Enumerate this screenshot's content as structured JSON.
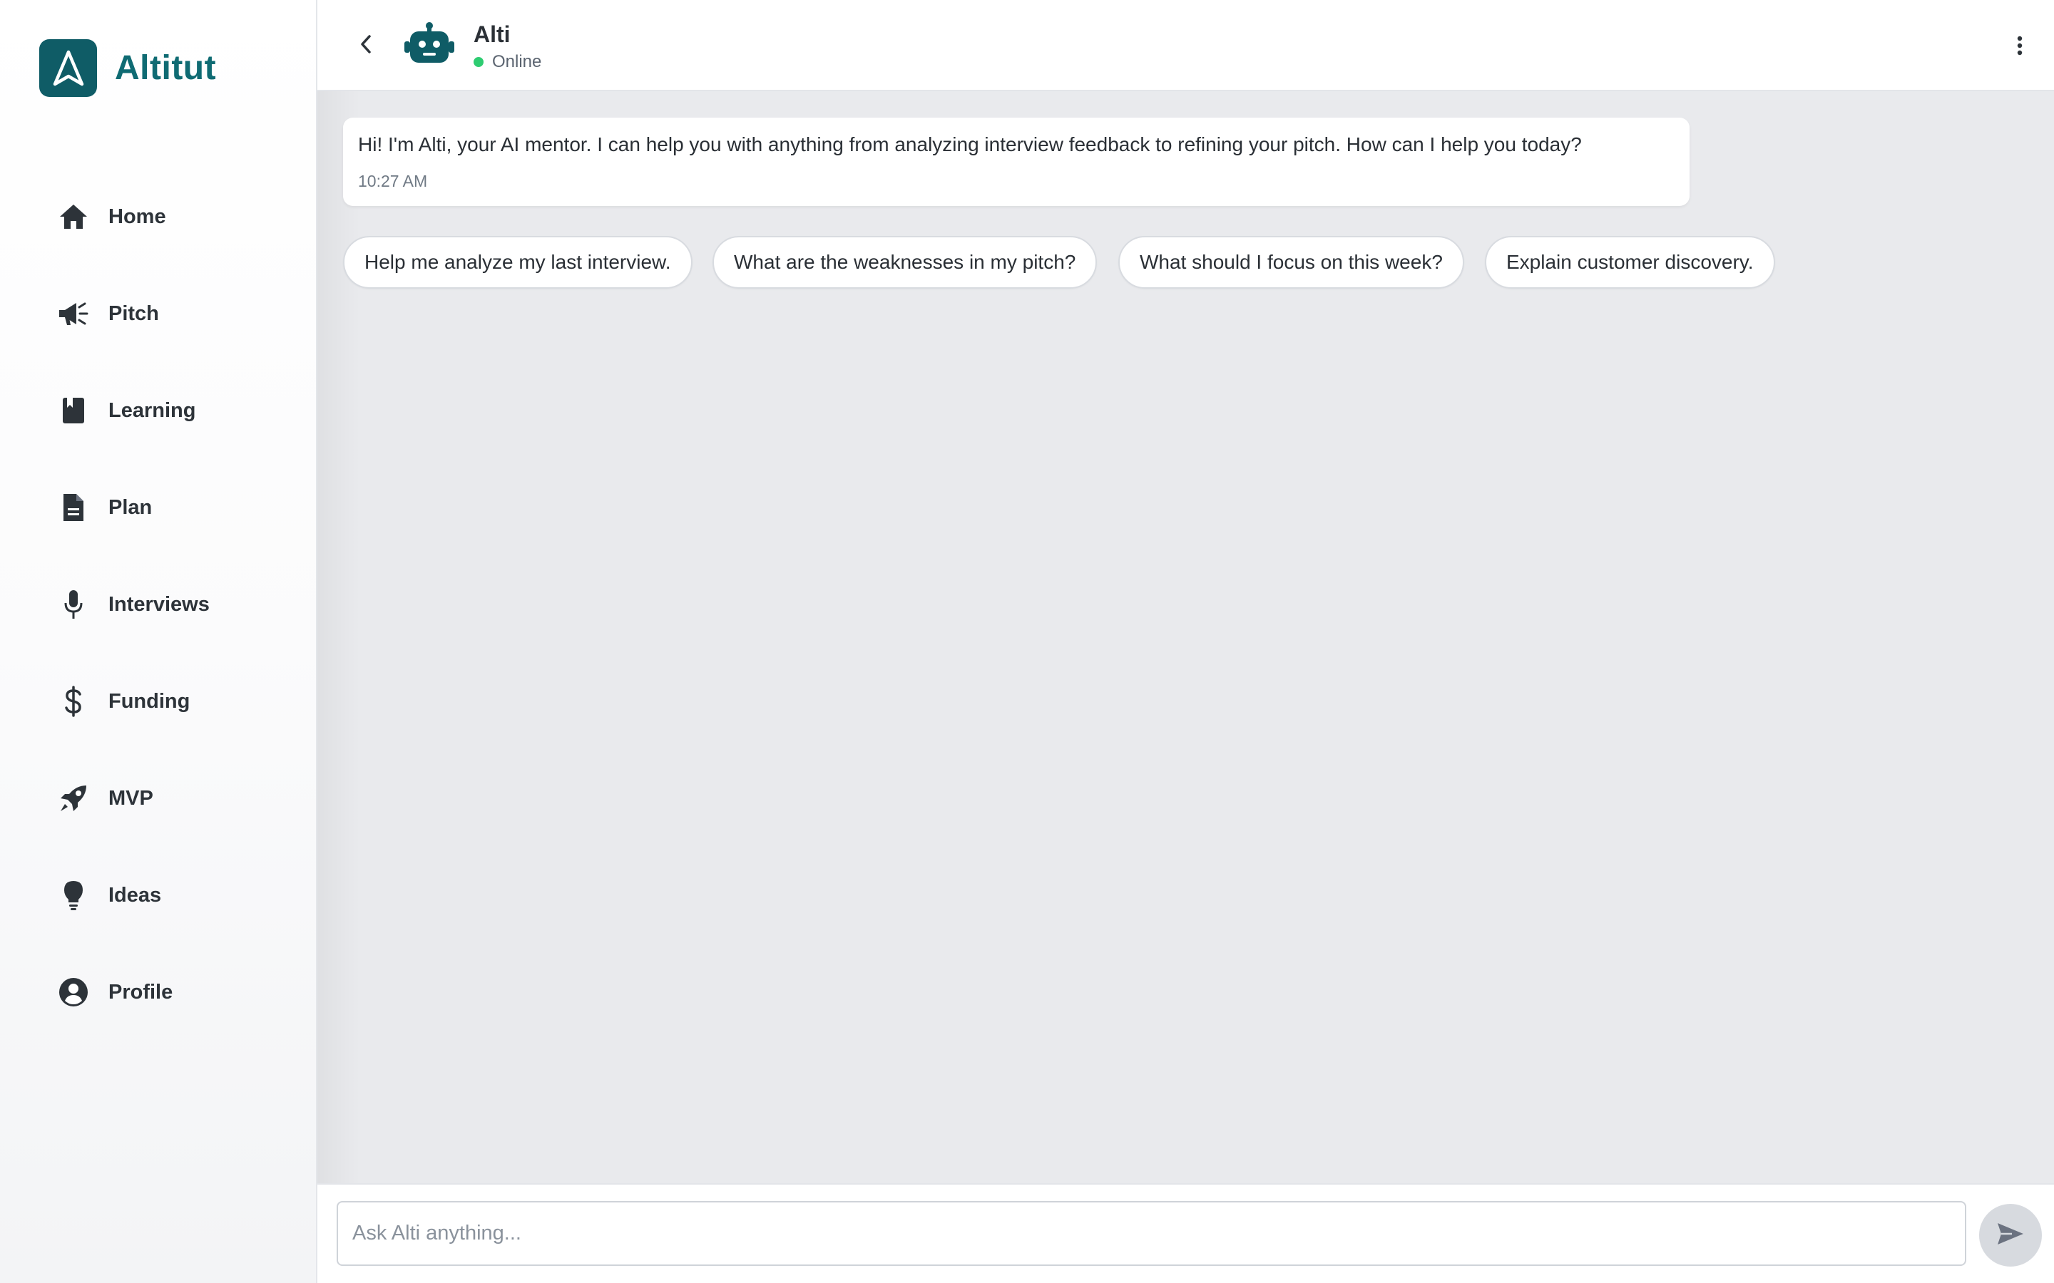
{
  "brand": {
    "name": "Altitut",
    "accent_color": "#0f5c66",
    "icon": "altitude-logo-icon"
  },
  "sidebar": {
    "items": [
      {
        "label": "Home",
        "icon": "home-icon"
      },
      {
        "label": "Pitch",
        "icon": "megaphone-icon"
      },
      {
        "label": "Learning",
        "icon": "book-icon"
      },
      {
        "label": "Plan",
        "icon": "document-icon"
      },
      {
        "label": "Interviews",
        "icon": "microphone-icon"
      },
      {
        "label": "Funding",
        "icon": "dollar-icon"
      },
      {
        "label": "MVP",
        "icon": "rocket-icon"
      },
      {
        "label": "Ideas",
        "icon": "lightbulb-icon"
      },
      {
        "label": "Profile",
        "icon": "user-circle-icon"
      }
    ]
  },
  "header": {
    "title": "Alti",
    "status": "Online",
    "status_color": "#2ecc71",
    "avatar_icon": "robot-icon"
  },
  "chat": {
    "messages": [
      {
        "text": "Hi! I'm Alti, your AI mentor. I can help you with anything from analyzing interview feedback to refining your pitch. How can I help you today?",
        "time": "10:27 AM"
      }
    ],
    "suggestions": [
      "Help me analyze my last interview.",
      "What are the weaknesses in my pitch?",
      "What should I focus on this week?",
      "Explain customer discovery."
    ]
  },
  "composer": {
    "placeholder": "Ask Alti anything...",
    "value": "",
    "send_icon": "send-icon"
  }
}
